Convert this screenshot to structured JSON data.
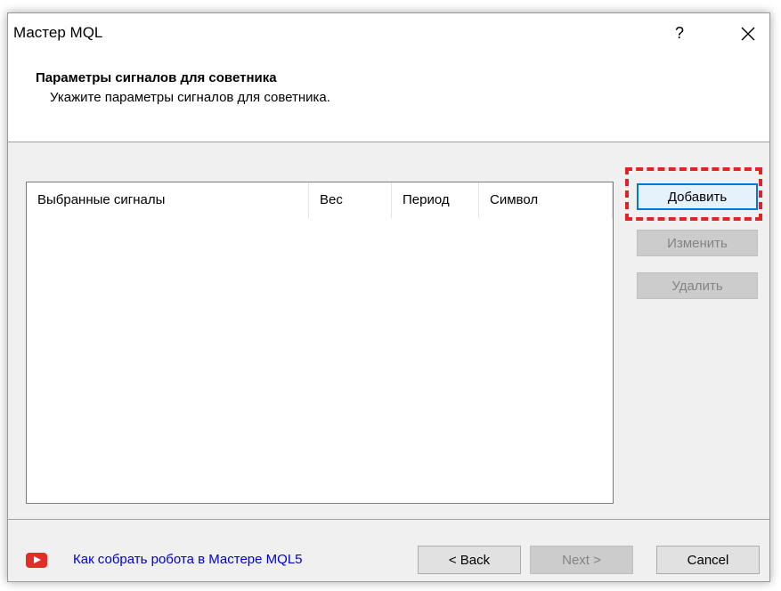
{
  "window": {
    "title": "Мастер MQL",
    "help_label": "?"
  },
  "header": {
    "title": "Параметры сигналов для советника",
    "subtitle": "Укажите параметры сигналов для советника."
  },
  "signals_table": {
    "columns": [
      "Выбранные сигналы",
      "Вес",
      "Период",
      "Символ"
    ],
    "rows": []
  },
  "side_buttons": {
    "add": "Добавить",
    "edit": "Изменить",
    "delete": "Удалить"
  },
  "footer": {
    "video_link": "Как собрать робота в Мастере MQL5",
    "back": "< Back",
    "next": "Next >",
    "cancel": "Cancel"
  },
  "colors": {
    "highlight": "#e02424",
    "link": "#0000cc",
    "youtube": "#e52d27",
    "focus": "#0078d7"
  },
  "icons": {
    "close": "close-icon",
    "video": "youtube-icon"
  }
}
